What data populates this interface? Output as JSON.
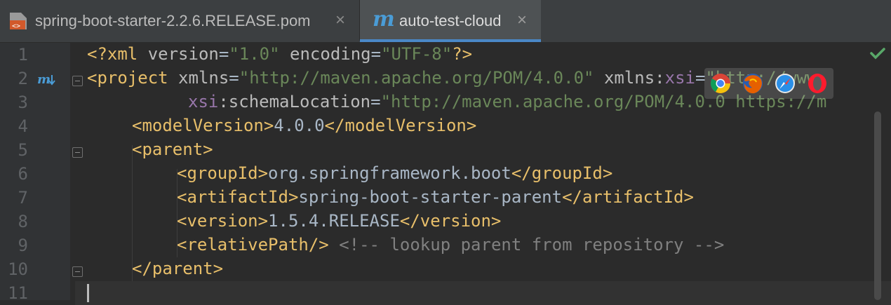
{
  "tabs": [
    {
      "label": "spring-boot-starter-2.2.6.RELEASE.pom",
      "icon": "pom-file-icon",
      "close": "×",
      "active": false
    },
    {
      "label": "auto-test-cloud",
      "icon": "maven-m-icon",
      "icon_glyph": "m",
      "close": "×",
      "active": true
    }
  ],
  "colors": {
    "tag": "#e8bf6a",
    "attribute": "#bababa",
    "namespace": "#9876aa",
    "string": "#6a8759",
    "text": "#a9b7c6",
    "comment": "#808080",
    "accent": "#4a88c7"
  },
  "gutter": {
    "line_numbers": [
      "1",
      "2",
      "3",
      "4",
      "5",
      "6",
      "7",
      "8",
      "9",
      "10",
      "11"
    ]
  },
  "code": {
    "l1": {
      "open": "<?xml ",
      "a1": "version",
      "eq1": "=",
      "v1": "\"1.0\"",
      "sp": " ",
      "a2": "encoding",
      "eq2": "=",
      "v2": "\"UTF-8\"",
      "close": "?>"
    },
    "l2": {
      "open": "<project ",
      "a1": "xmlns",
      "eq1": "=",
      "v1": "\"http://maven.apache.org/POM/4.0.0\"",
      "sp": " ",
      "a2": "xmlns:",
      "ns": "xsi",
      "eq2": "=",
      "v2": "\"http://www"
    },
    "l3": {
      "ns": "xsi",
      "a1": ":schemaLocation",
      "eq1": "=",
      "v1": "\"http://maven.apache.org/POM/4.0.0 https://m"
    },
    "l4": {
      "open": "<modelVersion>",
      "text": "4.0.0",
      "close": "</modelVersion>"
    },
    "l5": {
      "open": "<parent>"
    },
    "l6": {
      "open": "<groupId>",
      "text": "org.springframework.boot",
      "close": "</groupId>"
    },
    "l7": {
      "open": "<artifactId>",
      "text": "spring-boot-starter-parent",
      "close": "</artifactId>"
    },
    "l8": {
      "open": "<version>",
      "text": "1.5.4.RELEASE",
      "close": "</version>"
    },
    "l9": {
      "open": "<relativePath/>",
      "comment": " <!-- lookup parent from repository -->"
    },
    "l10": {
      "close": "</parent>"
    }
  },
  "browser_icons": [
    "chrome-icon",
    "firefox-icon",
    "safari-icon",
    "opera-icon"
  ],
  "status": {
    "inspection": "check-icon"
  }
}
